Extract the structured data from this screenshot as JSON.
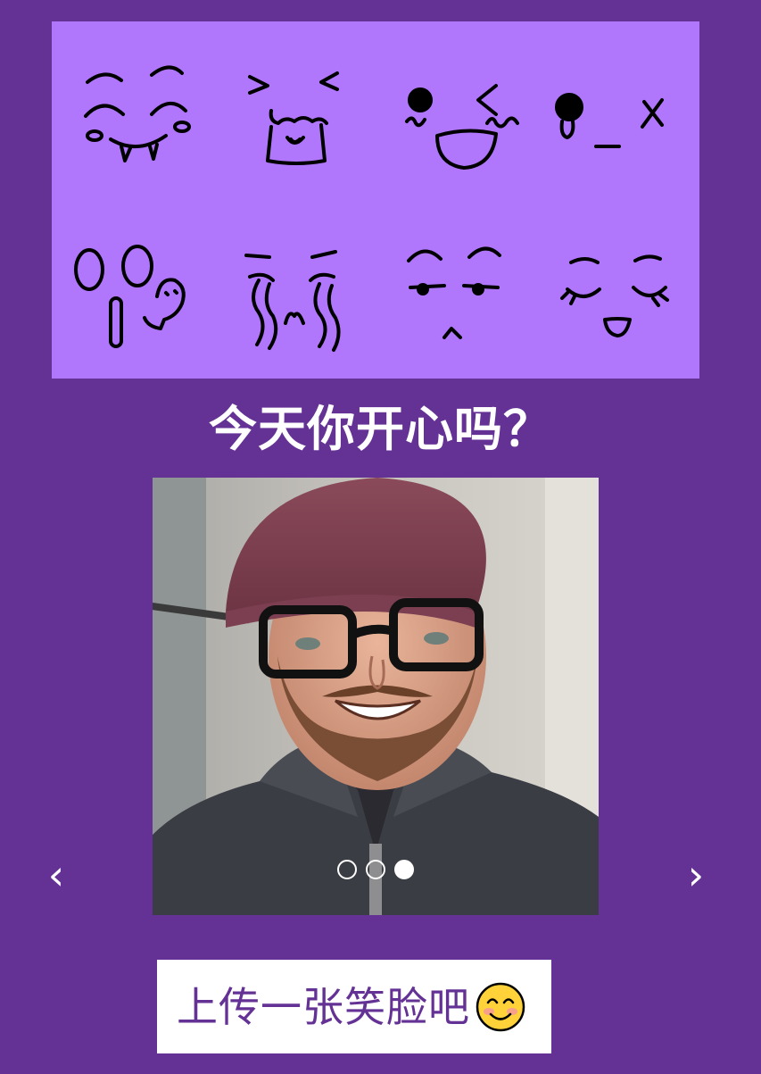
{
  "banner": {
    "icon": "kaomoji-faces-illustration",
    "color": "#b077fc"
  },
  "title": "今天你开心吗？",
  "carousel": {
    "slide_count": 3,
    "active_index": 2,
    "prev_label": "‹",
    "next_label": "›",
    "slide_description_icon": "smiling-man-photo"
  },
  "upload": {
    "label": "上传一张笑脸吧",
    "icon": "smiling-face-emoji"
  },
  "colors": {
    "background": "#643194",
    "banner": "#b077fc",
    "button_text": "#643194"
  }
}
